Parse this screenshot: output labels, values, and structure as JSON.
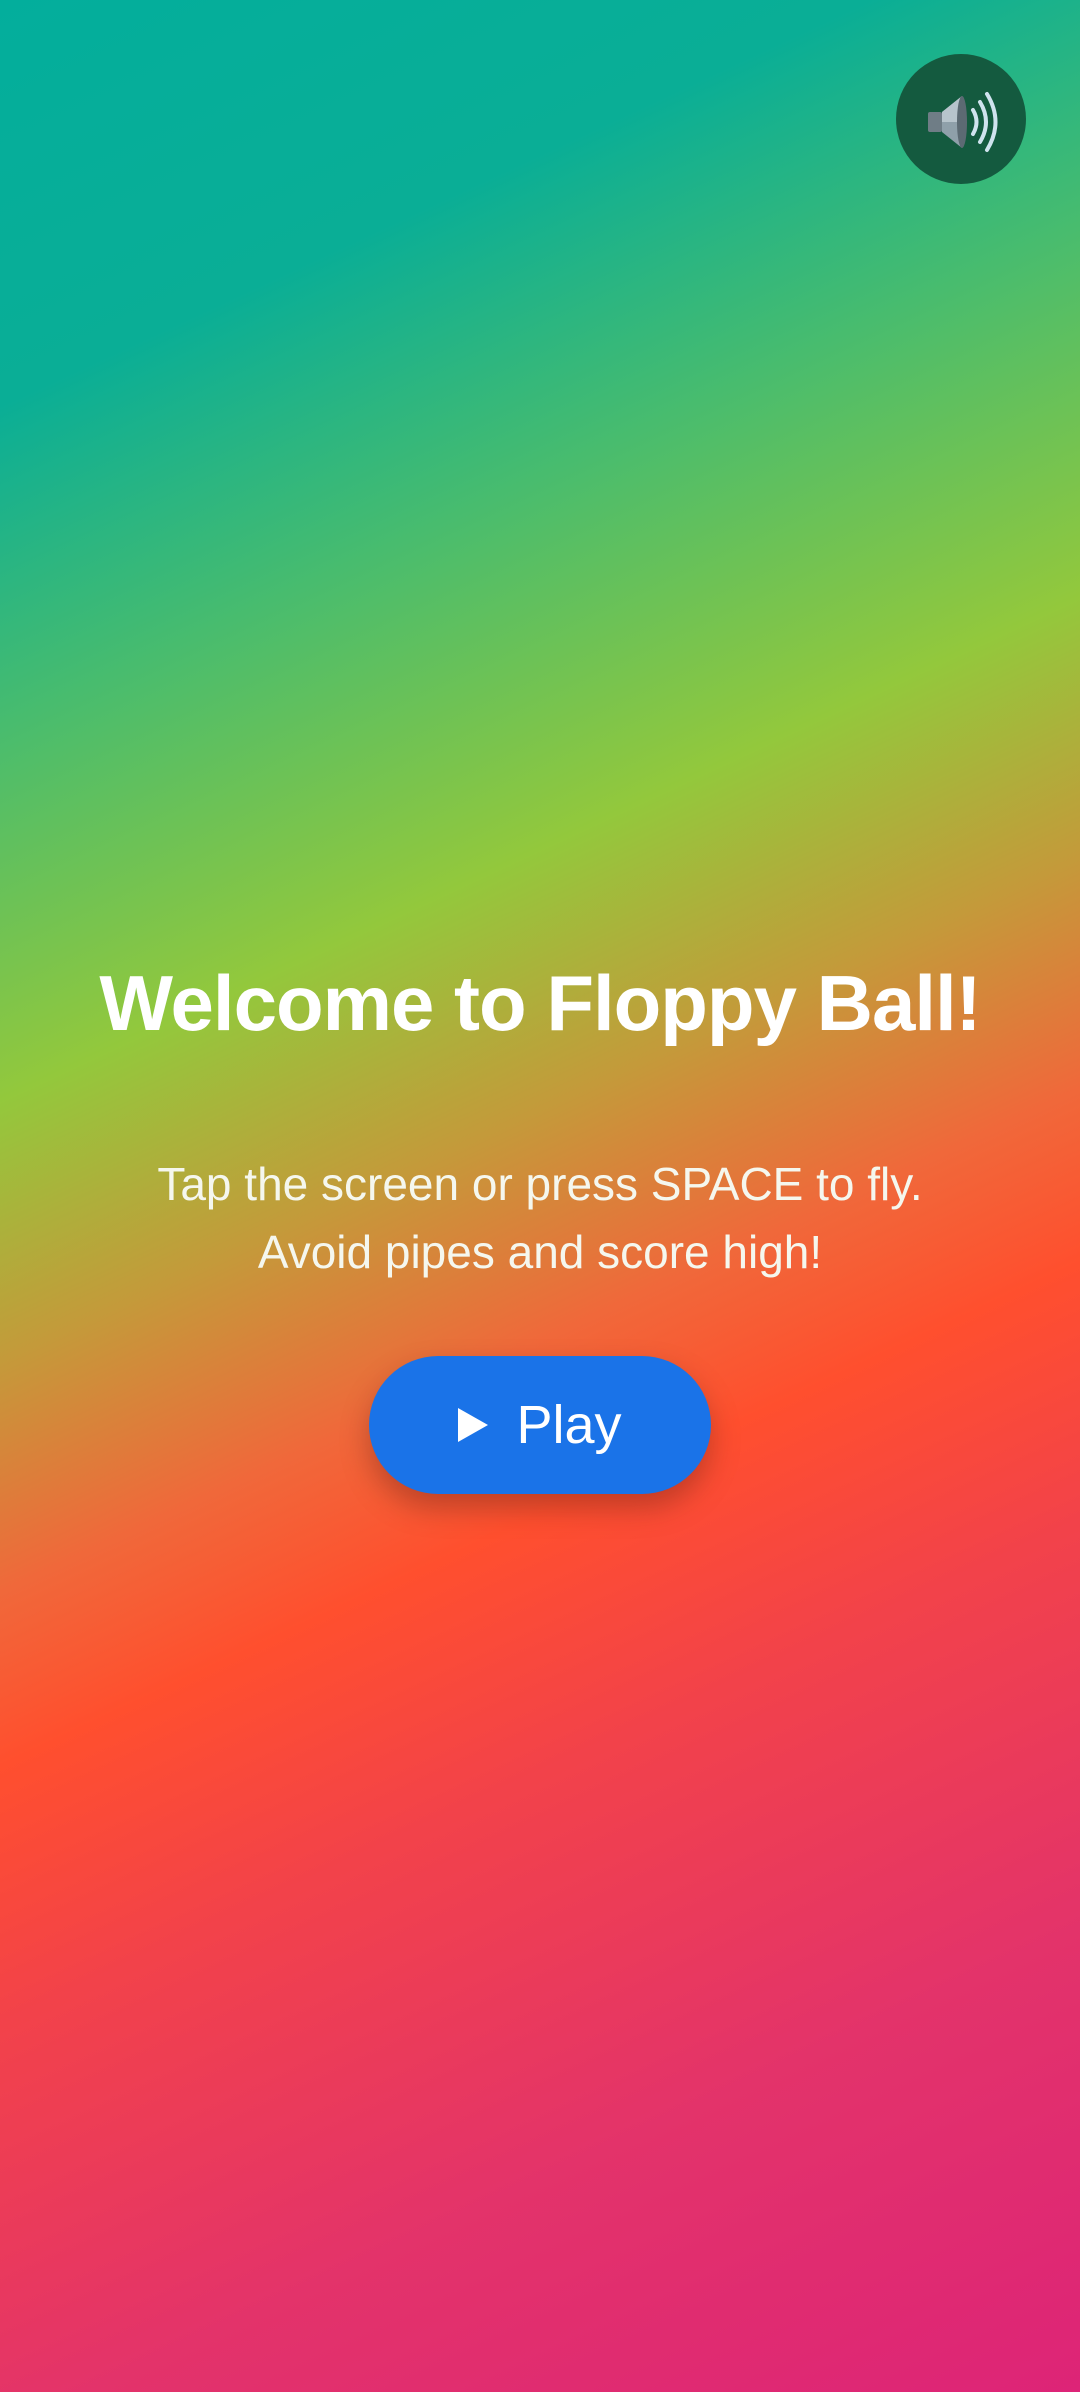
{
  "game": {
    "title": "Welcome to Floppy Ball!",
    "instructions": [
      "Tap the screen or press SPACE to fly.",
      "Avoid pipes and score high!"
    ],
    "play_button": {
      "icon": "play-triangle-icon",
      "label": "Play"
    }
  },
  "sound_toggle": {
    "icon": "speaker-high-volume-icon",
    "state": "on"
  },
  "colors": {
    "gradient": [
      "#03ae9c",
      "#93c83c",
      "#ff4f2e",
      "#dd2477"
    ],
    "play_button": "#1a73e8",
    "sound_button": "#145a3f"
  }
}
